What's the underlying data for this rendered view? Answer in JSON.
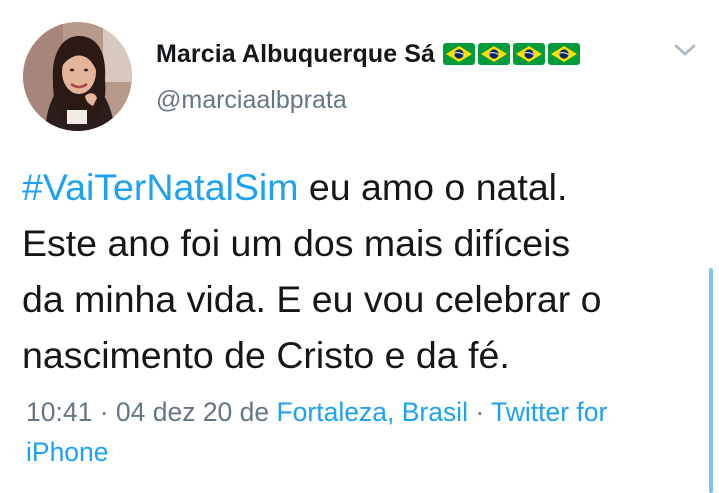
{
  "user": {
    "display_name": "Marcia Albuquerque Sá",
    "handle": "@marciaalbprata",
    "flag_emoji_count": 4,
    "flag_icon": "brazil-flag-icon"
  },
  "tweet": {
    "hashtag": "#VaiTerNatalSim",
    "line1_rest": " eu amo o natal.",
    "line2": "Este ano foi um dos mais difíceis",
    "line3": "da minha vida. E eu vou celebrar o",
    "line4": "nascimento de Cristo e da fé."
  },
  "meta": {
    "time": "10:41",
    "sep1": " · ",
    "date": "04 dez 20",
    "from_word": " de ",
    "location": "Fortaleza, Brasil",
    "sep2": " · ",
    "source_part1": "Twitter for",
    "source_part2": "iPhone"
  },
  "colors": {
    "link": "#1da1f2",
    "secondary_text": "#657786",
    "primary_text": "#14171a",
    "flag_green": "#009c3b",
    "flag_yellow": "#ffdf00",
    "flag_blue": "#002776"
  },
  "icons": {
    "caret": "chevron-down-icon"
  }
}
